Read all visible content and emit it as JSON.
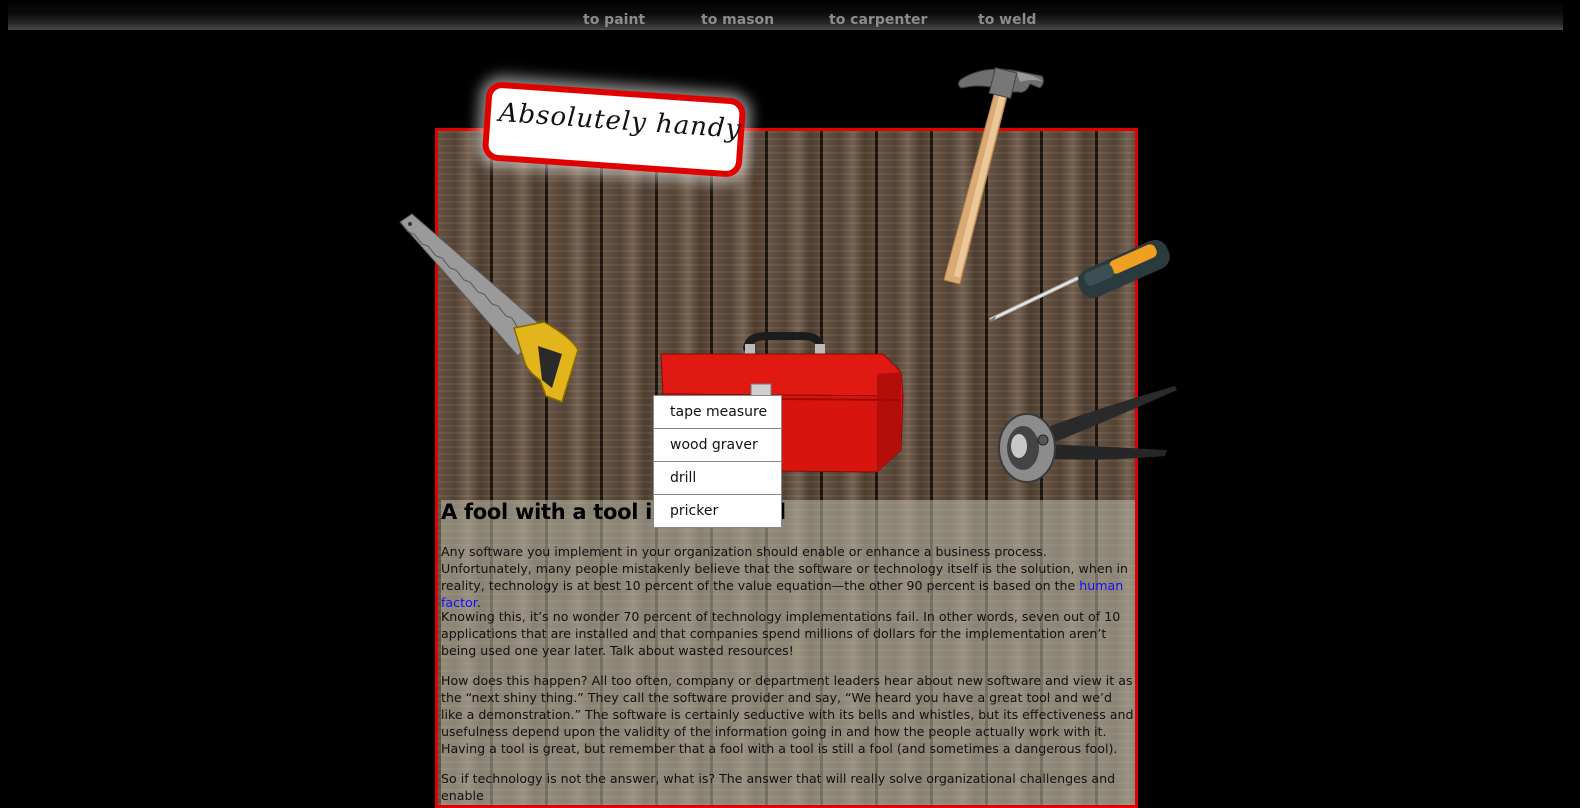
{
  "nav": {
    "items": [
      {
        "label": "to paint"
      },
      {
        "label": "to mason"
      },
      {
        "label": "to carpenter"
      },
      {
        "label": "to weld"
      }
    ]
  },
  "logo": {
    "text": "Absolutely handy"
  },
  "menu": {
    "items": [
      {
        "label": "tape measure"
      },
      {
        "label": "wood graver"
      },
      {
        "label": "drill"
      },
      {
        "label": "pricker"
      }
    ]
  },
  "article": {
    "heading": "A fool with a tool is still a fool",
    "p1_text": "Any software you implement in your organization should enable or enhance a business process. Unfortunately, many people mistakenly believe that the software or technology itself is the solution, when in reality, technology is at best 10 percent of the value equation—the other 90 percent is based on the",
    "p1_link": "human factor",
    "p1_end": ".",
    "p2": "Knowing this, it’s no wonder 70 percent of technology implementations fail. In other words, seven out of 10 applications that are installed and that companies spend millions of dollars for the implementation aren’t being used one year later. Talk about wasted resources!",
    "p3": "How does this happen? All too often, company or department leaders hear about new software and view it as the “next shiny thing.” They call the software provider and say, “We heard you have a great tool and we’d like a demonstration.” The software is certainly seductive with its bells and whistles, but its effectiveness and usefulness depend upon the validity of the information going in and how the people actually work with it. Having a tool is great, but remember that a fool with a tool is still a fool (and sometimes a dangerous fool).",
    "p4": "So if technology is not the answer, what is? The answer that will really solve organizational challenges and enable"
  },
  "icons": [
    "hammer-icon",
    "screwdriver-icon",
    "saw-icon",
    "toolbox-icon",
    "pliers-icon"
  ],
  "colors": {
    "accent": "#e00000",
    "link": "#1010ff",
    "nav_text": "#8c8c8c"
  }
}
